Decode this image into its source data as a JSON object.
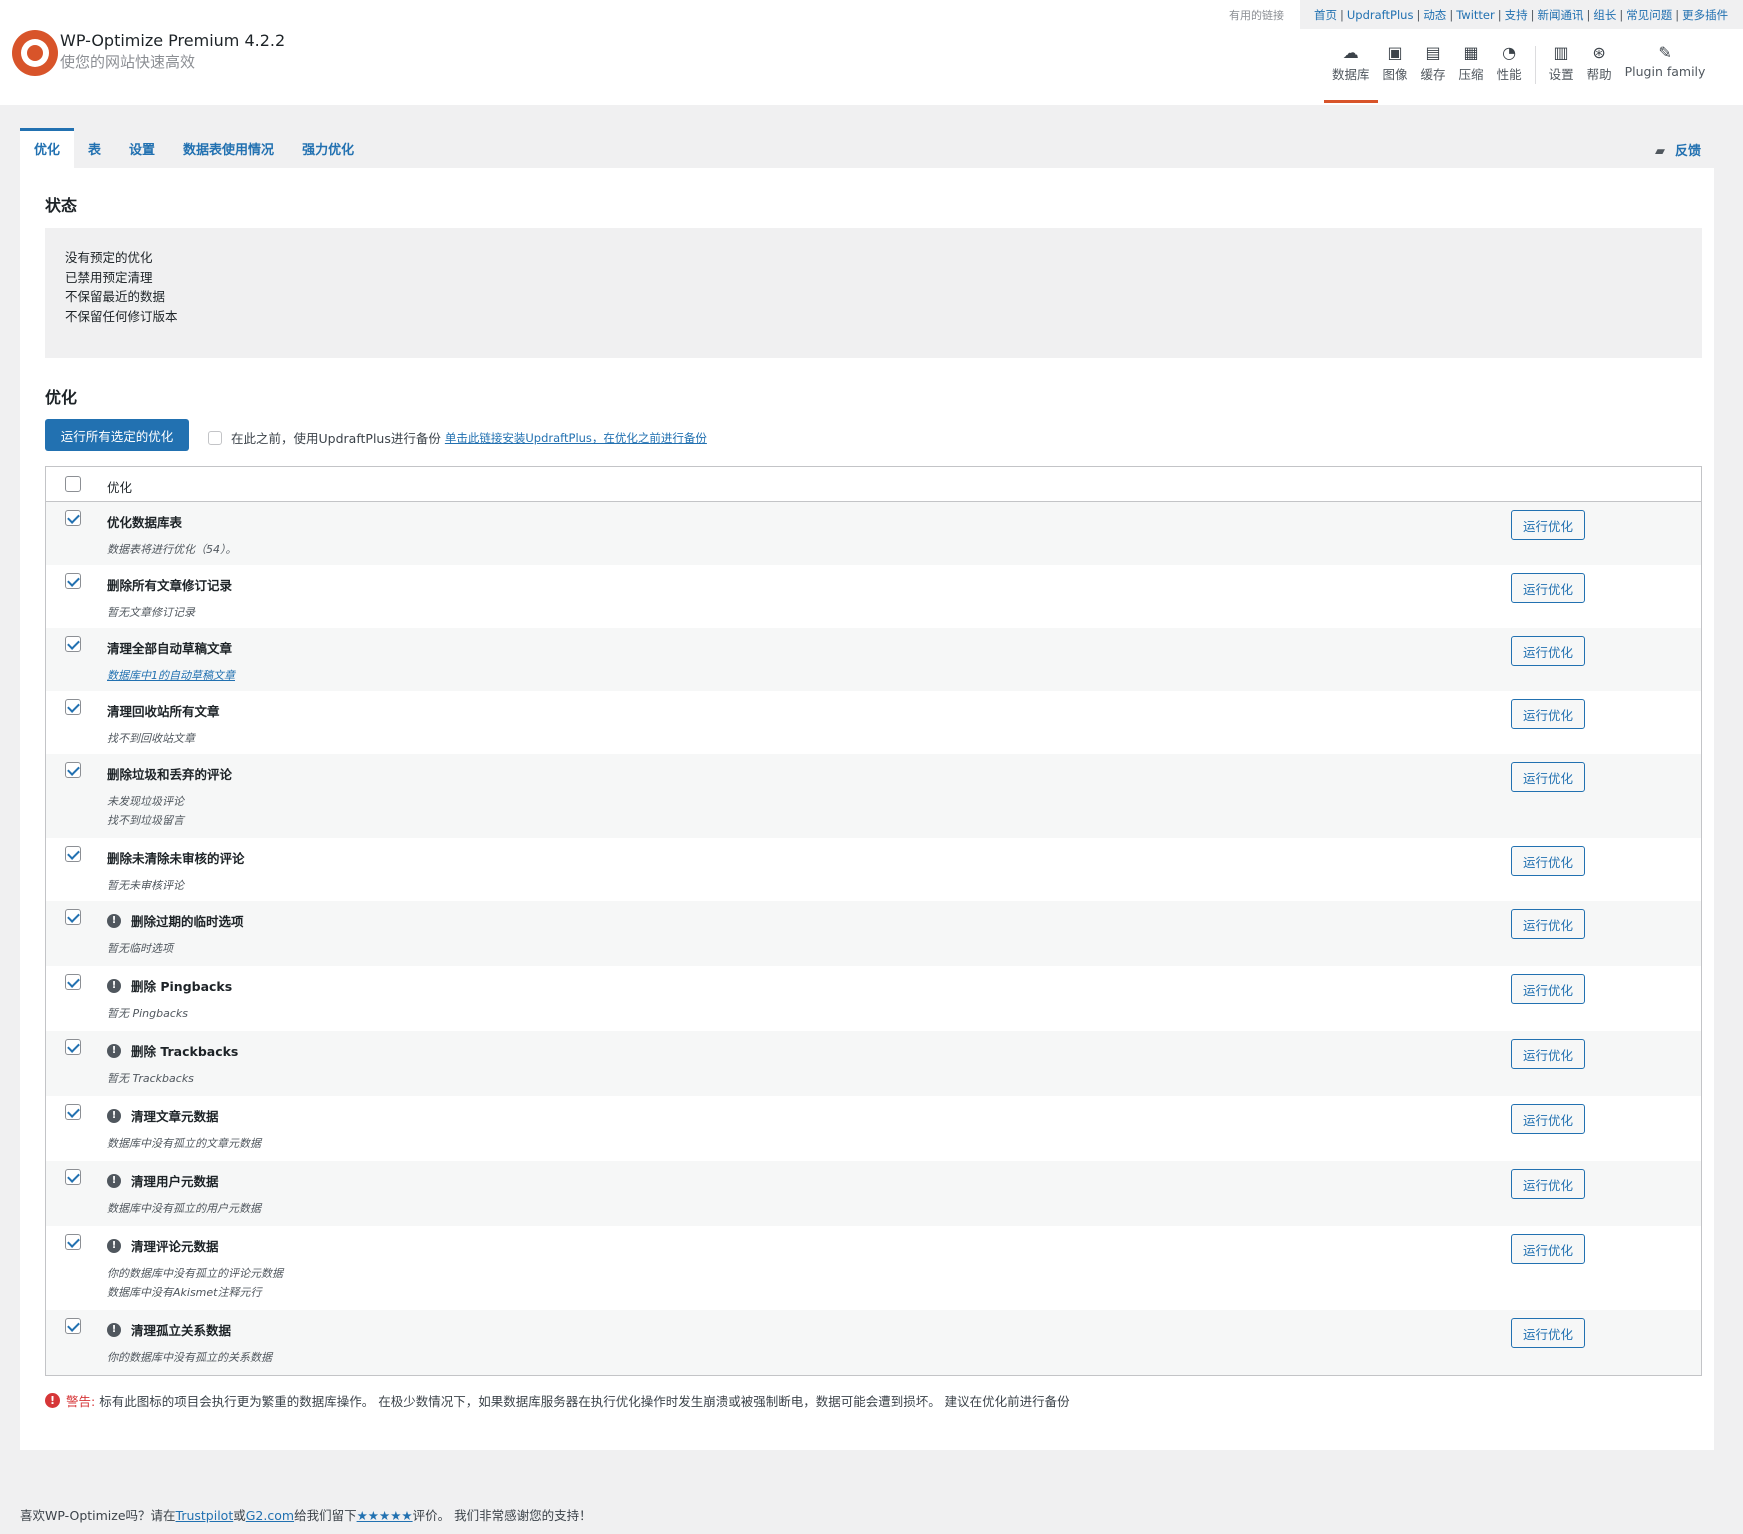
{
  "header": {
    "brand_title": "WP-Optimize Premium 4.2.2",
    "brand_subtitle": "使您的网站快速高效",
    "links_label": "有用的链接",
    "links": [
      "首页",
      "UpdraftPlus",
      "动态",
      "Twitter",
      "支持",
      "新闻通讯",
      "组长",
      "常见问题",
      "更多插件"
    ],
    "nav": [
      {
        "label": "数据库",
        "icon": "cloud-icon",
        "glyph": "☁"
      },
      {
        "label": "图像",
        "icon": "images-icon",
        "glyph": "▣"
      },
      {
        "label": "缓存",
        "icon": "archive-icon",
        "glyph": "▤"
      },
      {
        "label": "压缩",
        "icon": "grid-icon",
        "glyph": "▦"
      },
      {
        "label": "性能",
        "icon": "dashboard-icon",
        "glyph": "◔"
      },
      {
        "label": "设置",
        "icon": "settings-icon",
        "glyph": "▥"
      },
      {
        "label": "帮助",
        "icon": "sos-icon",
        "glyph": "⊛"
      },
      {
        "label": "Plugin family",
        "icon": "plugin-icon",
        "glyph": "✎"
      }
    ]
  },
  "tabs": [
    "优化",
    "表",
    "设置",
    "数据表使用情况",
    "强力优化"
  ],
  "feedback_label": "反馈",
  "status": {
    "heading": "状态",
    "lines": [
      "没有预定的优化",
      "已禁用预定清理",
      "不保留最近的数据",
      "不保留任何修订版本"
    ]
  },
  "optimize": {
    "heading": "优化",
    "run_all_label": "运行所有选定的优化",
    "backup_text": "在此之前，使用UpdraftPlus进行备份",
    "backup_link": "单击此链接安装UpdraftPlus，在优化之前进行备份",
    "table_header": "优化",
    "run_label": "运行优化",
    "rows": [
      {
        "title": "优化数据库表",
        "warn": false,
        "desc": [
          "数据表将进行优化（54）。"
        ],
        "link": false
      },
      {
        "title": "删除所有文章修订记录",
        "warn": false,
        "desc": [
          "暂无文章修订记录"
        ],
        "link": false
      },
      {
        "title": "清理全部自动草稿文章",
        "warn": false,
        "desc": [
          "数据库中1的自动草稿文章"
        ],
        "link": true
      },
      {
        "title": "清理回收站所有文章",
        "warn": false,
        "desc": [
          "找不到回收站文章"
        ],
        "link": false
      },
      {
        "title": "删除垃圾和丢弃的评论",
        "warn": false,
        "desc": [
          "未发现垃圾评论",
          "找不到垃圾留言"
        ],
        "link": false
      },
      {
        "title": "删除未清除未审核的评论",
        "warn": false,
        "desc": [
          "暂无未审核评论"
        ],
        "link": false
      },
      {
        "title": "删除过期的临时选项",
        "warn": true,
        "desc": [
          "暂无临时选项"
        ],
        "link": false
      },
      {
        "title": "删除 Pingbacks",
        "warn": true,
        "desc": [
          "暂无 Pingbacks"
        ],
        "link": false
      },
      {
        "title": "删除 Trackbacks",
        "warn": true,
        "desc": [
          "暂无 Trackbacks"
        ],
        "link": false
      },
      {
        "title": "清理文章元数据",
        "warn": true,
        "desc": [
          "数据库中没有孤立的文章元数据"
        ],
        "link": false
      },
      {
        "title": "清理用户元数据",
        "warn": true,
        "desc": [
          "数据库中没有孤立的用户元数据"
        ],
        "link": false
      },
      {
        "title": "清理评论元数据",
        "warn": true,
        "desc": [
          "你的数据库中没有孤立的评论元数据",
          "数据库中没有Akismet注释元行"
        ],
        "link": false
      },
      {
        "title": "清理孤立关系数据",
        "warn": true,
        "desc": [
          "你的数据库中没有孤立的关系数据"
        ],
        "link": false
      }
    ],
    "warning_label": "警告:",
    "warning_text": "标有此图标的项目会执行更为繁重的数据库操作。 在极少数情况下，如果数据库服务器在执行优化操作时发生崩溃或被强制断电，数据可能会遭到损坏。 建议在优化前进行备份"
  },
  "footer": {
    "prefix": "喜欢WP-Optimize吗？请在",
    "link1": "Trustpilot",
    "or": "或",
    "link2": "G2.com",
    "mid": "给我们留下",
    "stars": "★★★★★",
    "suffix": "评价。 我们非常感谢您的支持！"
  },
  "colors": {
    "accent": "#2271b1",
    "brand": "#d8542a",
    "danger": "#d63638"
  }
}
